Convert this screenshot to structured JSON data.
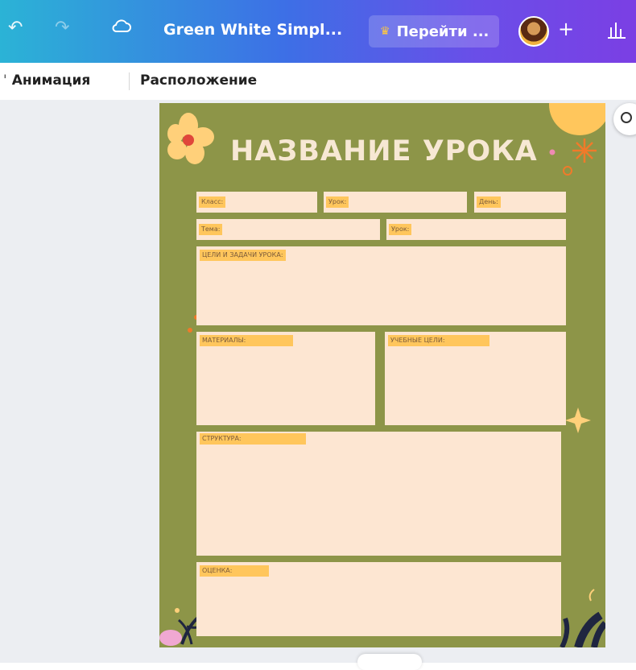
{
  "toolbar": {
    "doc_title": "Green White Simpl...",
    "upgrade_label": "Перейти ...",
    "plus": "+",
    "icons": [
      "undo-icon",
      "redo-icon",
      "cloud-icon",
      "crown-icon",
      "avatar",
      "plus-icon",
      "chart-icon"
    ]
  },
  "menu": {
    "items": [
      "Анимация",
      "Расположение"
    ]
  },
  "page": {
    "title": "НАЗВАНИЕ УРОКА",
    "fields": {
      "class": "Класс:",
      "lesson": "Урок:",
      "day": "День:",
      "topic": "Тема:",
      "level": "Урок:",
      "goals": "ЦЕЛИ И ЗАДАЧИ УРОКА:",
      "materials": "МАТЕРИАЛЫ:",
      "learning_goals": "УЧЕБНЫЕ ЦЕЛИ:",
      "structure": "СТРУКТУРА:",
      "assessment": "ОЦЕНКА:"
    }
  },
  "colors": {
    "page_bg": "#8d9548",
    "box_bg": "#fde6d2",
    "label_bg": "#ffc65c",
    "title_color": "#f7e8d4",
    "accent_orange": "#f07a2a",
    "accent_pink": "#f08ab3"
  }
}
